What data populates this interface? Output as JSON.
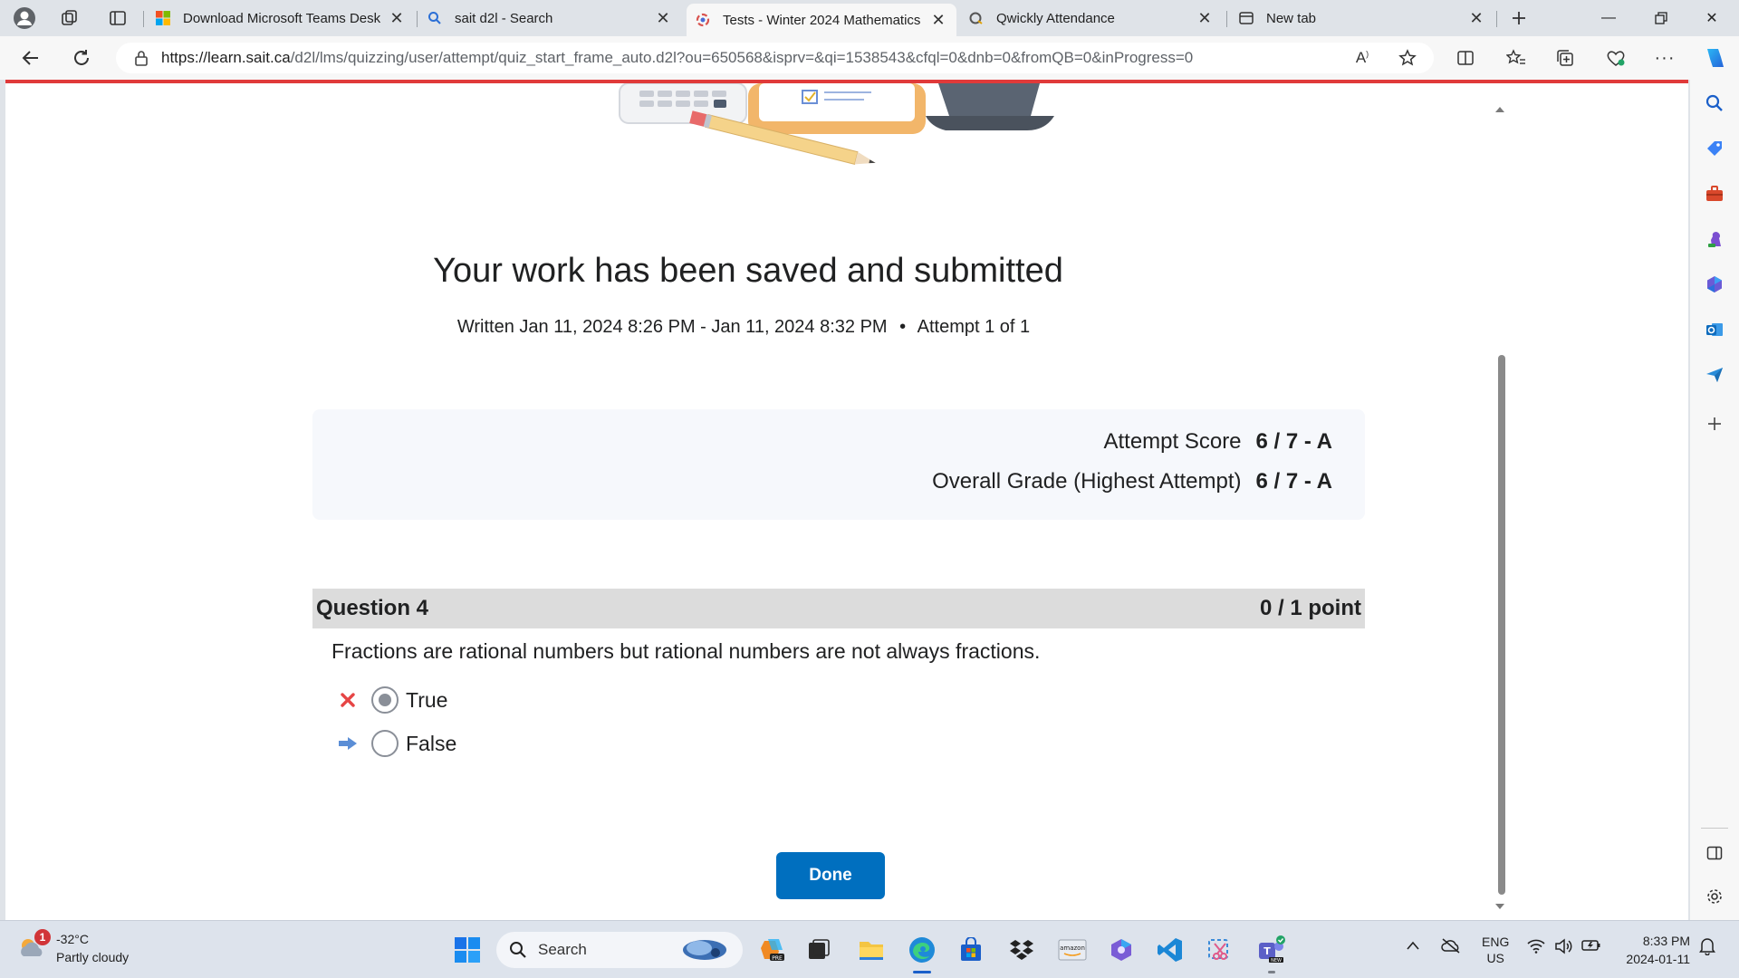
{
  "browser": {
    "tabs": [
      {
        "title": "Download Microsoft Teams Desk",
        "icon": "microsoft-logo-icon"
      },
      {
        "title": "sait d2l - Search",
        "icon": "search-icon"
      },
      {
        "title": "Tests - Winter 2024 Mathematics",
        "icon": "d2l-icon",
        "active": true
      },
      {
        "title": "Qwickly Attendance",
        "icon": "qwickly-icon"
      },
      {
        "title": "New tab",
        "icon": "newtab-icon"
      }
    ],
    "url_domain": "https://learn.sait.ca",
    "url_path": "/d2l/lms/quizzing/user/attempt/quiz_start_frame_auto.d2l?ou=650568&isprv=&qi=1538543&cfql=0&dnb=0&fromQB=0&inProgress=0"
  },
  "page": {
    "headline": "Your work has been saved and submitted",
    "written": "Written Jan 11, 2024 8:26 PM - Jan 11, 2024 8:32 PM",
    "bullet": "•",
    "attempt": "Attempt 1 of 1",
    "attempt_score_label": "Attempt Score",
    "attempt_score_value": "6 / 7 - A",
    "overall_grade_label": "Overall Grade (Highest Attempt)",
    "overall_grade_value": "6 / 7 - A",
    "question_title": "Question 4",
    "question_points": "0 / 1 point",
    "question_text": "Fractions are rational numbers but rational numbers are not always fractions.",
    "options": [
      {
        "label": "True",
        "selected": true,
        "mark": "incorrect-x-icon"
      },
      {
        "label": "False",
        "selected": false,
        "mark": "correct-answer-arrow-icon"
      }
    ],
    "done_label": "Done"
  },
  "taskbar": {
    "weather_badge": "1",
    "temperature": "-32°C",
    "condition": "Partly cloudy",
    "search_placeholder": "Search",
    "language": "ENG",
    "region": "US",
    "time": "8:33 PM",
    "date": "2024-01-11"
  },
  "colors": {
    "accent_button": "#006fbf",
    "progress_line": "#e03a3a",
    "incorrect": "#e64545",
    "correct_arrow": "#5b8ed6"
  }
}
